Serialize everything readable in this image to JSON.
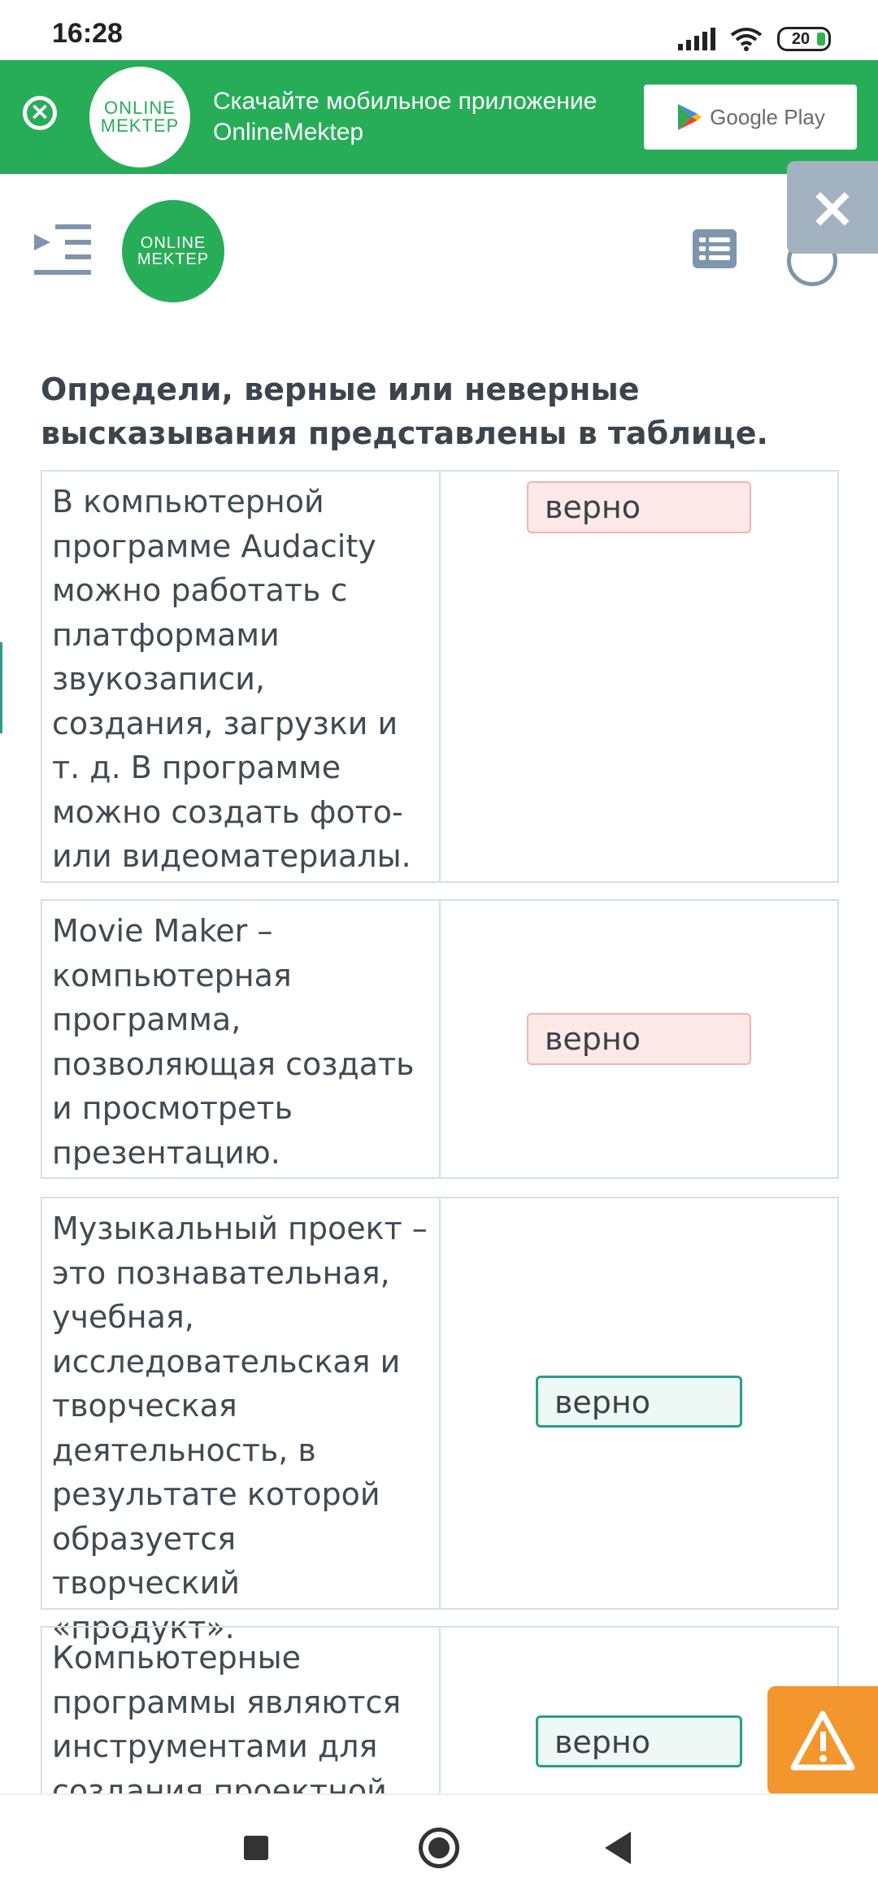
{
  "status_bar": {
    "time": "16:28",
    "battery": "20"
  },
  "banner": {
    "logo_line1": "ONLINE",
    "logo_line2": "MEKTEP",
    "text_line1": "Скачайте мобильное приложение",
    "text_line2": "OnlineMektep",
    "store_button": "Google Play"
  },
  "header": {
    "logo_line1": "ONLINE",
    "logo_line2": "MEKTEP"
  },
  "question": "Определи, верные или неверные высказывания представлены в таблице.",
  "rows": [
    {
      "statement": "В компьютерной программе Audacity можно работать с платформами звукозаписи, создания, загрузки и т. д. В программе можно создать фото- или видеоматериалы.",
      "answer": "верно",
      "status": "incorrect"
    },
    {
      "statement": "Movie Maker – компьютерная программа, позволяющая создать и просмотреть презентацию.",
      "answer": "верно",
      "status": "incorrect"
    },
    {
      "statement": "Музыкальный проект – это познавательная, учебная, исследовательская и творческая деятельность, в результате которой образуется творческий «продукт».",
      "answer": "верно",
      "status": "correct"
    },
    {
      "statement": "Компьютерные программы являются инструментами для создания проектной",
      "answer": "верно",
      "status": "correct"
    }
  ],
  "colors": {
    "brand_green": "#27ad58",
    "incorrect_bg": "#fde9e7",
    "correct_border": "#2a9d8a",
    "warning": "#f3962e"
  }
}
